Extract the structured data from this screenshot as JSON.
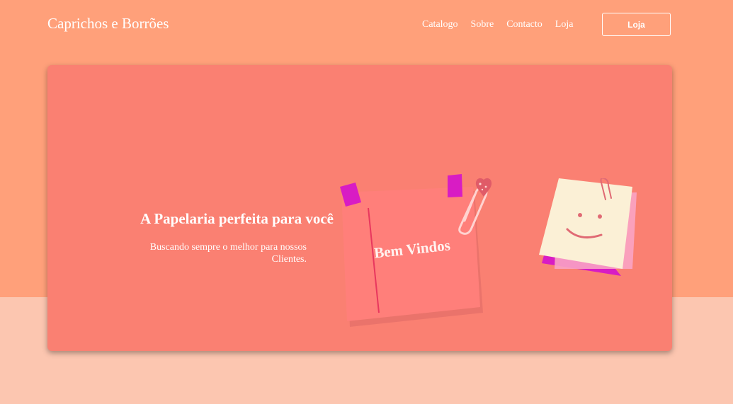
{
  "brand": {
    "name": "Caprichos e Borrões"
  },
  "nav": {
    "links": [
      "Catalogo",
      "Sobre",
      "Contacto",
      "Loja"
    ],
    "button_label": "Loja"
  },
  "hero": {
    "title": "A Papelaria perfeita para você",
    "subtitle": "Buscando sempre o melhor para nossos Clientes.",
    "note_text": "Bem Vindos"
  },
  "colors": {
    "header_bg": "#ffa07a",
    "page_bg": "#fcc6b0",
    "card_bg": "#fa8072",
    "note_pink": "#ff7f7a",
    "tape_magenta": "#d81cc4"
  },
  "icons": [
    "heart-icon",
    "paperclip-icon",
    "smiley-icon"
  ]
}
